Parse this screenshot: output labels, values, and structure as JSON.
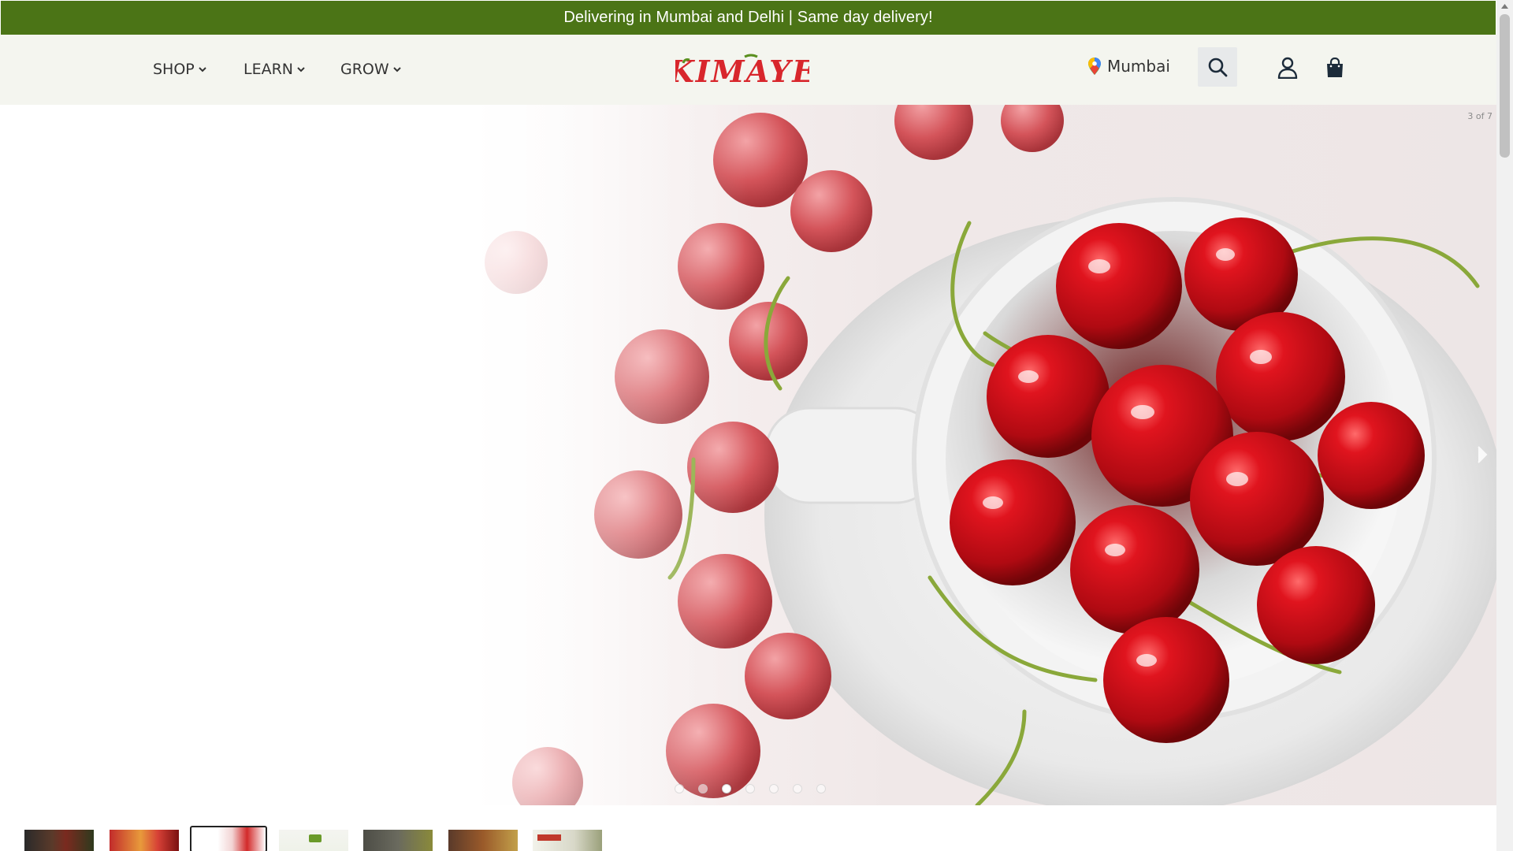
{
  "announcement": {
    "text": "Delivering in Mumbai and Delhi | Same day delivery!"
  },
  "header": {
    "nav": [
      {
        "label": "SHOP"
      },
      {
        "label": "LEARN"
      },
      {
        "label": "GROW"
      }
    ],
    "logo_text": "KIMĀYE",
    "location": {
      "label": "Mumbai"
    },
    "icons": [
      "location-pin-icon",
      "search-icon",
      "account-icon",
      "cart-icon"
    ]
  },
  "hero": {
    "slide_counter": "3 of 7",
    "current_slide": 3,
    "total_slides": 7,
    "image_subject": "cherries in a white cup"
  },
  "colors": {
    "announcement_bg": "#4b7416",
    "header_bg": "#f4f5ef",
    "logo_red": "#d8262c",
    "logo_green": "#5a8f1f"
  }
}
